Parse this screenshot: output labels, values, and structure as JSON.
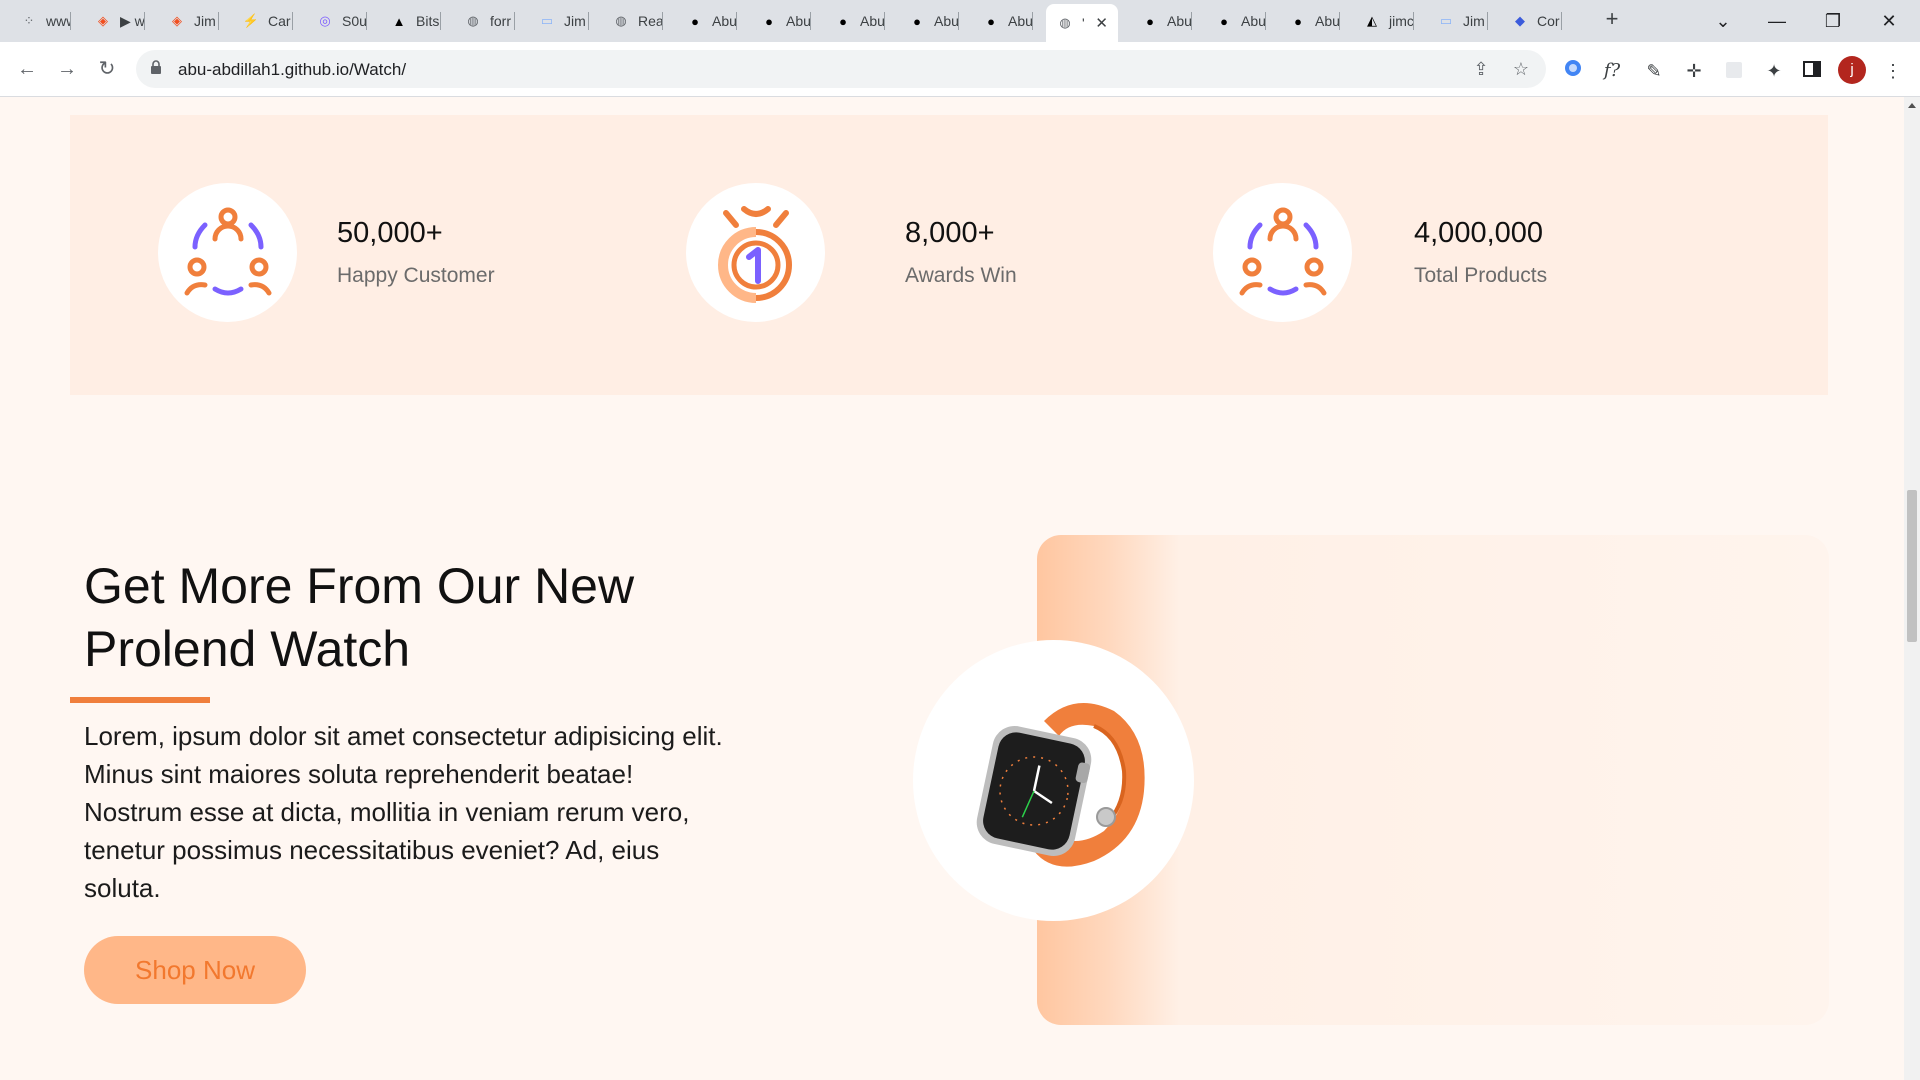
{
  "browser": {
    "tabs": [
      {
        "title": "www",
        "icon": "dots-icon",
        "color": "#5f6368"
      },
      {
        "title": "▶ w",
        "icon": "figma-icon",
        "color": "#f24e1e"
      },
      {
        "title": "Jim",
        "icon": "figma-icon",
        "color": "#f24e1e"
      },
      {
        "title": "Car",
        "icon": "bolt-icon",
        "color": "#2bb673"
      },
      {
        "title": "S0u",
        "icon": "spiral-icon",
        "color": "#7c5cff"
      },
      {
        "title": "Bits",
        "icon": "triangle-icon",
        "color": "#000000"
      },
      {
        "title": "forr",
        "icon": "globe-icon",
        "color": "#5f6368"
      },
      {
        "title": "Jim",
        "icon": "window-icon",
        "color": "#8ab4f8"
      },
      {
        "title": "Rea",
        "icon": "globe-icon",
        "color": "#5f6368"
      },
      {
        "title": "Abu",
        "icon": "github-icon",
        "color": "#000000"
      },
      {
        "title": "Abu",
        "icon": "github-icon",
        "color": "#000000"
      },
      {
        "title": "Abu",
        "icon": "github-icon",
        "color": "#000000"
      },
      {
        "title": "Abu",
        "icon": "github-icon",
        "color": "#000000"
      },
      {
        "title": "Abu",
        "icon": "github-icon",
        "color": "#000000"
      },
      {
        "title": "'",
        "icon": "globe-icon",
        "color": "#5f6368",
        "active": true
      },
      {
        "title": "Abu",
        "icon": "github-icon",
        "color": "#000000"
      },
      {
        "title": "Abu",
        "icon": "github-icon",
        "color": "#000000"
      },
      {
        "title": "Abu",
        "icon": "github-icon",
        "color": "#000000"
      },
      {
        "title": "jimc",
        "icon": "circle-triangle-icon",
        "color": "#000000"
      },
      {
        "title": "Jim",
        "icon": "window-icon",
        "color": "#8ab4f8"
      },
      {
        "title": "Cor",
        "icon": "shield-icon",
        "color": "#3b5bdb"
      }
    ],
    "new_tab": "+",
    "url": "abu-abdillah1.github.io/Watch/",
    "profile_initial": "j"
  },
  "stats": [
    {
      "value": "50,000+",
      "label": "Happy Customer",
      "icon": "people-circle-icon"
    },
    {
      "value": "8,000+",
      "label": "Awards Win",
      "icon": "medal-icon"
    },
    {
      "value": "4,000,000",
      "label": "Total Products",
      "icon": "people-circle-icon"
    }
  ],
  "promo": {
    "title_line1": "Get More From Our New",
    "title_line2": "Prolend Watch",
    "body": "Lorem, ipsum dolor sit amet consectetur adipisicing elit. Minus sint maiores soluta reprehenderit beatae! Nostrum esse at dicta, mollitia in veniam rerum vero, tenetur possimus necessitatibus eveniet? Ad, eius soluta.",
    "button": "Shop Now"
  },
  "colors": {
    "accent": "#f07f3c",
    "purple": "#7b61ff",
    "section_bg": "#ffeee4",
    "page_bg": "#fff7f2",
    "button_bg": "#ffb788"
  }
}
